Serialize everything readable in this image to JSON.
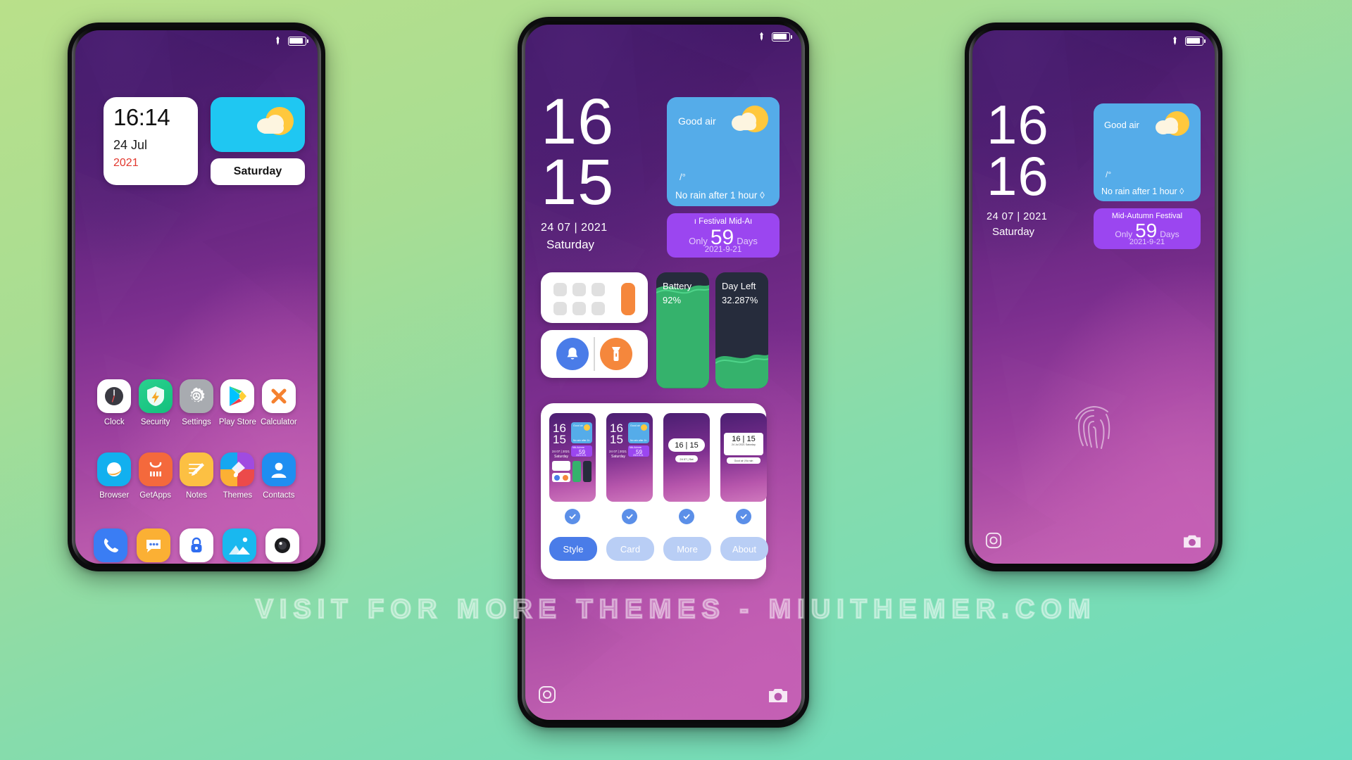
{
  "watermark": "VISIT FOR MORE THEMES - MIUITHEMER.COM",
  "colors": {
    "accent_purple": "#9b46f0",
    "weather_blue": "#55ace9",
    "weather_cyan": "#1fc7f2",
    "battery_green": "#35b26c",
    "dark_slate": "#262c3c",
    "orange": "#f5873c",
    "tab_active": "#4a7ce8",
    "tab_inactive": "#b9cef5",
    "year_red": "#e2392f"
  },
  "status_bar": {
    "pin_icon": "pin-icon",
    "battery_icon": "battery-icon"
  },
  "phone1": {
    "clock_widget": {
      "time": "16:14",
      "date": "24 Jul",
      "year": "2021"
    },
    "weather_widget": {
      "icon": "sun-behind-cloud-icon"
    },
    "day_button": {
      "label": "Saturday"
    },
    "apps_row1": [
      {
        "label": "Clock",
        "icon": "clock-icon"
      },
      {
        "label": "Security",
        "icon": "shield-icon"
      },
      {
        "label": "Settings",
        "icon": "gear-icon"
      },
      {
        "label": "Play Store",
        "icon": "play-store-icon"
      },
      {
        "label": "Calculator",
        "icon": "close-x-icon"
      }
    ],
    "apps_row2": [
      {
        "label": "Browser",
        "icon": "browser-icon"
      },
      {
        "label": "GetApps",
        "icon": "mi-getapps-icon"
      },
      {
        "label": "Notes",
        "icon": "notes-icon"
      },
      {
        "label": "Themes",
        "icon": "themes-brush-icon"
      },
      {
        "label": "Contacts",
        "icon": "contacts-person-icon"
      }
    ],
    "dock": [
      {
        "label": "Phone",
        "icon": "phone-handset-icon"
      },
      {
        "label": "Messages",
        "icon": "message-bubble-icon"
      },
      {
        "label": "Security Lock",
        "icon": "lock-icon"
      },
      {
        "label": "Gallery",
        "icon": "gallery-image-icon"
      },
      {
        "label": "Camera",
        "icon": "camera-icon"
      }
    ]
  },
  "phone2": {
    "clock": {
      "hour": "16",
      "minute": "15",
      "date": "24 07 | 2021",
      "weekday": "Saturday"
    },
    "weather": {
      "air": "Good air",
      "temp": "/°",
      "forecast": "No rain after 1 hour ◊",
      "icon": "sun-behind-cloud-icon"
    },
    "festival": {
      "title": "ı Festival        Mid-Aı",
      "only": "Only",
      "count": "59",
      "days": "Days",
      "date": "2021-9-21"
    },
    "calculator_widget": {
      "icon": "calculator-keypad-icon"
    },
    "toggles": [
      {
        "icon": "bell-icon",
        "name": "ringer-toggle"
      },
      {
        "icon": "flashlight-icon",
        "name": "flashlight-toggle"
      }
    ],
    "battery_card": {
      "label": "Battery",
      "value": "92%"
    },
    "dayleft_card": {
      "label": "Day Left",
      "value": "32.287%"
    },
    "panel": {
      "thumbnails": [
        {
          "name": "style-thumb-1",
          "selected": true
        },
        {
          "name": "style-thumb-2",
          "selected": true
        },
        {
          "name": "style-thumb-3",
          "selected": true
        },
        {
          "name": "style-thumb-4",
          "selected": true
        }
      ],
      "thumb_clock": {
        "hour": "16",
        "minute": "15",
        "inline": "16 | 15"
      },
      "tabs": [
        {
          "label": "Style",
          "active": true
        },
        {
          "label": "Card",
          "active": false
        },
        {
          "label": "More",
          "active": false
        },
        {
          "label": "About",
          "active": false
        }
      ]
    },
    "lock_bottom": {
      "left_icon": "camera-lens-icon",
      "right_icon": "camera-icon"
    }
  },
  "phone3": {
    "clock": {
      "hour": "16",
      "minute": "16",
      "date": "24 07 | 2021",
      "weekday": "Saturday"
    },
    "weather": {
      "air": "Good air",
      "temp": "/°",
      "forecast": "No rain after 1 hour ◊",
      "icon": "sun-behind-cloud-icon"
    },
    "festival": {
      "title": "Mid-Autumn Festival",
      "only": "Only",
      "count": "59",
      "days": "Days",
      "date": "2021-9-21"
    },
    "fingerprint_icon": "fingerprint-icon",
    "lock_bottom": {
      "left_icon": "camera-lens-icon",
      "right_icon": "camera-icon"
    }
  }
}
